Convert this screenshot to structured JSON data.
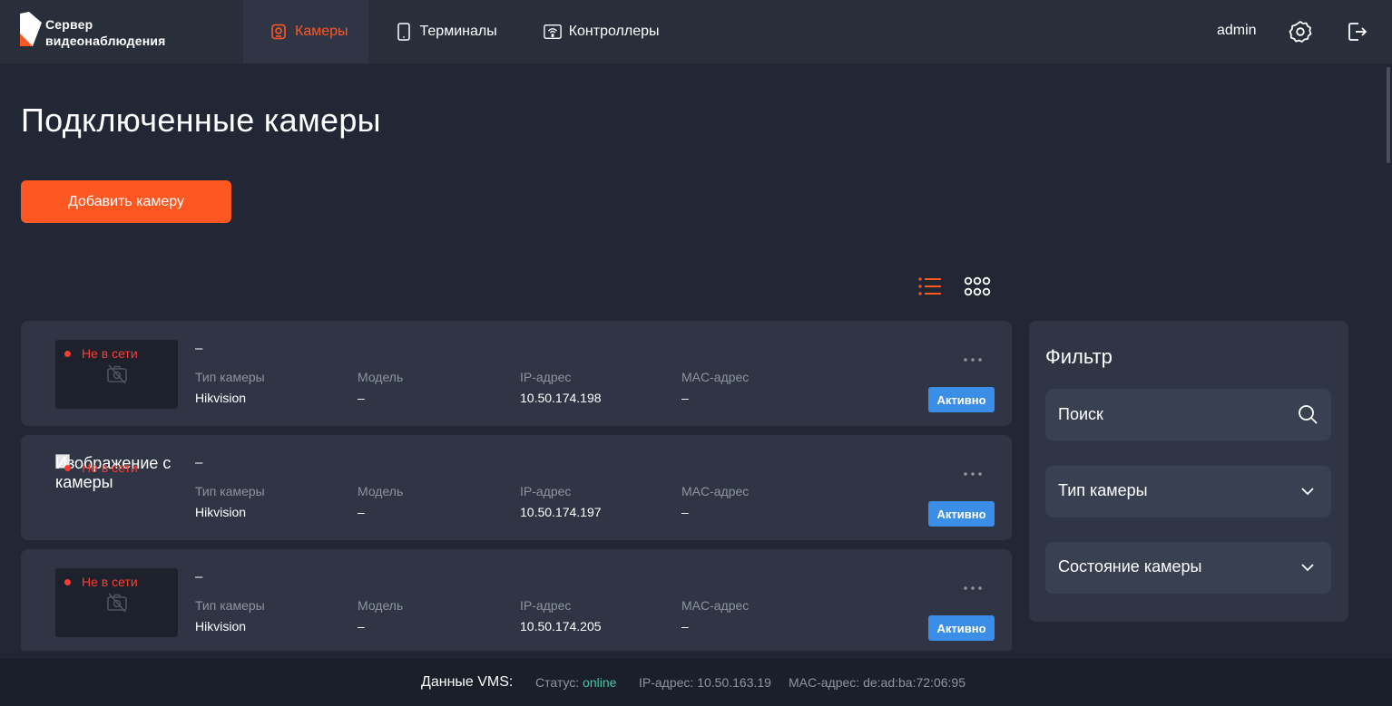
{
  "app": {
    "logo_line1": "Сервер",
    "logo_line2": "видеонаблюдения",
    "accent_color": "#ff5722"
  },
  "nav": {
    "items": [
      {
        "label": "Камеры",
        "icon": "camera-icon",
        "active": true
      },
      {
        "label": "Терминалы",
        "icon": "tablet-icon",
        "active": false
      },
      {
        "label": "Контроллеры",
        "icon": "controller-icon",
        "active": false
      }
    ]
  },
  "header": {
    "username": "admin",
    "settings_icon": "gear-icon",
    "logout_icon": "logout-icon"
  },
  "page": {
    "title": "Подключенные камеры",
    "add_button": "Добавить камеру"
  },
  "view_toggle": {
    "list_icon": "list-view-icon",
    "grid_icon": "grid-view-icon",
    "active": "list"
  },
  "cameras": {
    "labels": {
      "type": "Тип камеры",
      "model": "Модель",
      "ip": "IP-адрес",
      "mac": "MAC-адрес",
      "offline": "Не в сети"
    },
    "items": [
      {
        "name": "–",
        "type": "Hikvision",
        "model": "–",
        "ip": "10.50.174.198",
        "mac": "–",
        "status": "Активно",
        "thumb_broken": false
      },
      {
        "name": "–",
        "type": "Hikvision",
        "model": "–",
        "ip": "10.50.174.197",
        "mac": "–",
        "status": "Активно",
        "thumb_broken": true,
        "thumb_alt": "Изображение с камеры"
      },
      {
        "name": "–",
        "type": "Hikvision",
        "model": "–",
        "ip": "10.50.174.205",
        "mac": "–",
        "status": "Активно",
        "thumb_broken": false
      }
    ]
  },
  "filter": {
    "title": "Фильтр",
    "search_placeholder": "Поиск",
    "camera_type": "Тип камеры",
    "camera_state": "Состояние камеры"
  },
  "footer": {
    "vms_label": "Данные VMS:",
    "status_label": "Статус:",
    "status_value": "online",
    "ip_label": "IP-адрес:",
    "ip_value": "10.50.163.19",
    "mac_label": "MAC-адрес:",
    "mac_value": "de:ad:ba:72:06:95",
    "online_color": "#3cc8a0"
  }
}
